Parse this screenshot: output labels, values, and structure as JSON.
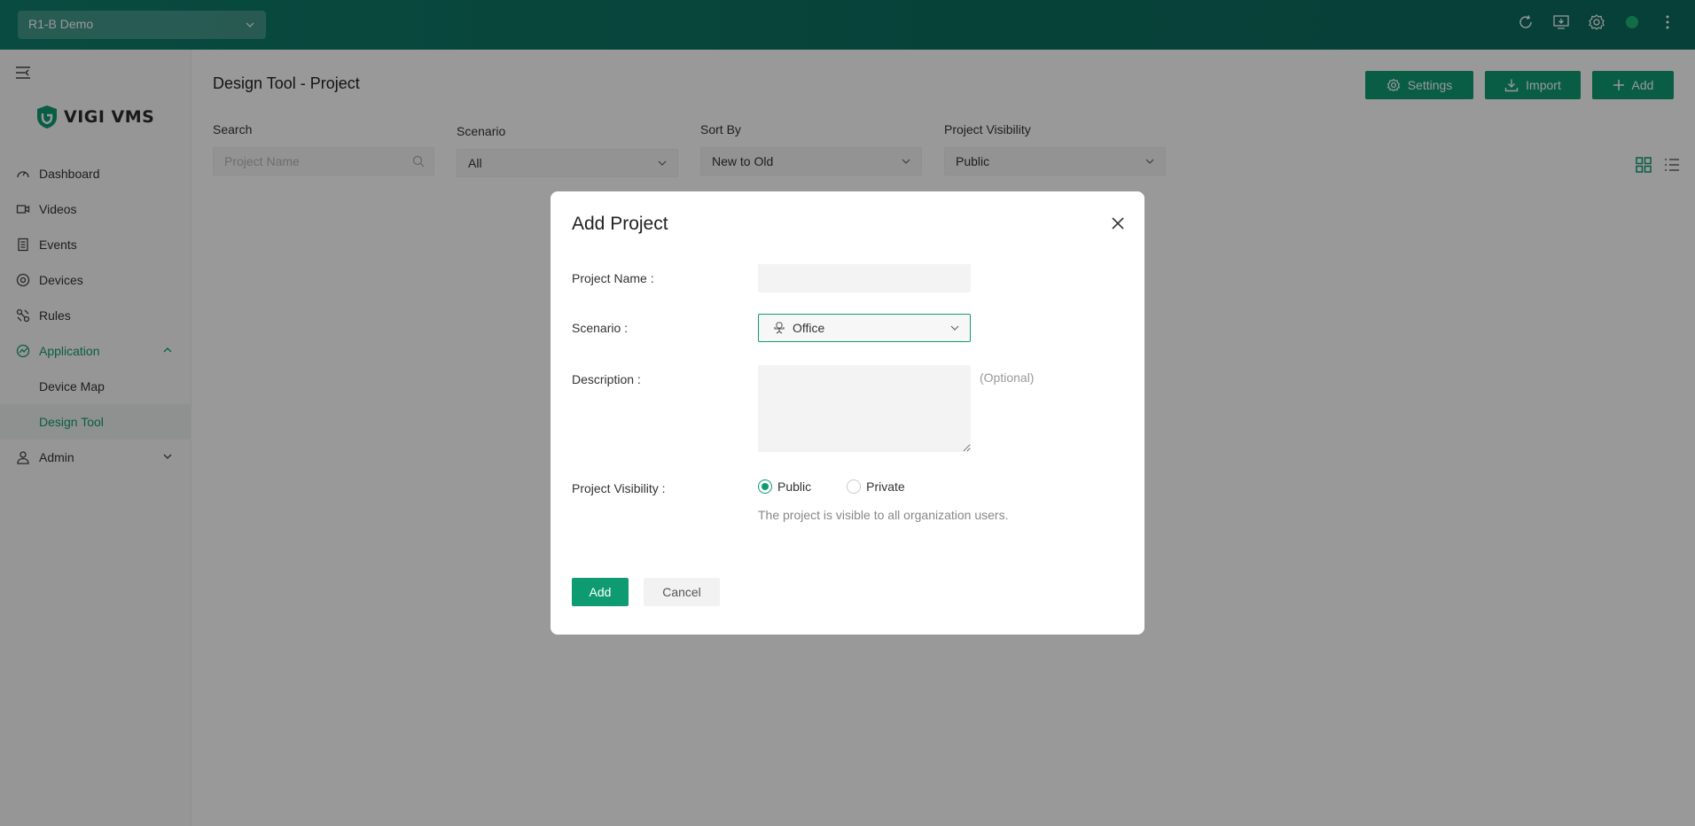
{
  "topbar": {
    "site_name": "R1-B Demo",
    "icons": [
      "refresh-icon",
      "download-client-icon",
      "settings-icon",
      "status-dot",
      "more-icon"
    ]
  },
  "sidebar": {
    "logo_text": "VIGI VMS",
    "items": [
      {
        "label": "Dashboard",
        "icon": "dashboard-icon"
      },
      {
        "label": "Videos",
        "icon": "video-icon"
      },
      {
        "label": "Events",
        "icon": "events-icon"
      },
      {
        "label": "Devices",
        "icon": "devices-icon"
      },
      {
        "label": "Rules",
        "icon": "rules-icon"
      },
      {
        "label": "Application",
        "icon": "application-icon",
        "expanded": true
      },
      {
        "label": "Device Map"
      },
      {
        "label": "Design Tool",
        "active": true
      },
      {
        "label": "Admin",
        "icon": "admin-icon"
      }
    ]
  },
  "main": {
    "title": "Design Tool - Project",
    "buttons": {
      "settings": "Settings",
      "import": "Import",
      "add": "Add"
    },
    "filters": {
      "search_label": "Search",
      "search_placeholder": "Project Name",
      "scenario_label": "Scenario",
      "scenario_value": "All",
      "sort_label": "Sort By",
      "sort_value": "New to Old",
      "visibility_label": "Project Visibility",
      "visibility_value": "Public"
    }
  },
  "dialog": {
    "title": "Add Project",
    "project_name_label": "Project Name :",
    "project_name_value": "",
    "scenario_label": "Scenario :",
    "scenario_value": "Office",
    "description_label": "Description :",
    "description_hint": "(Optional)",
    "visibility_label": "Project Visibility :",
    "visibility_options": [
      "Public",
      "Private"
    ],
    "visibility_selected": "Public",
    "visibility_helper": "The project is visible to all organization users.",
    "add_label": "Add",
    "cancel_label": "Cancel"
  },
  "colors": {
    "brand_green": "#0f9b72",
    "topbar_green": "#0f7e6b",
    "overlay": "rgba(0,0,0,0.4)"
  }
}
